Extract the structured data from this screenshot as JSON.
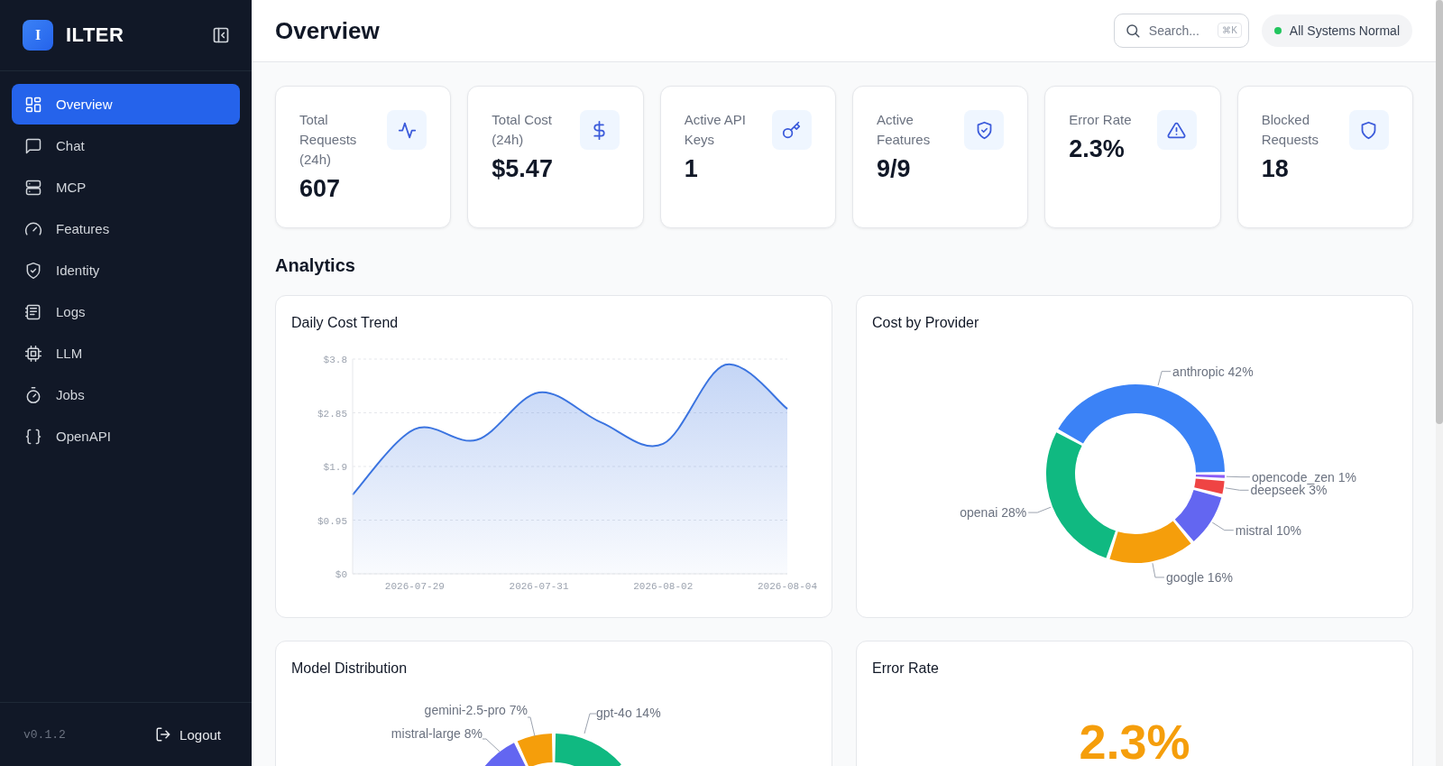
{
  "brand": {
    "logo_letter": "I",
    "name": "ILTER"
  },
  "sidebar": {
    "items": [
      {
        "label": "Overview",
        "selected": true
      },
      {
        "label": "Chat",
        "selected": false
      },
      {
        "label": "MCP",
        "selected": false
      },
      {
        "label": "Features",
        "selected": false
      },
      {
        "label": "Identity",
        "selected": false
      },
      {
        "label": "Logs",
        "selected": false
      },
      {
        "label": "LLM",
        "selected": false
      },
      {
        "label": "Jobs",
        "selected": false
      },
      {
        "label": "OpenAPI",
        "selected": false
      }
    ],
    "version": "v0.1.2",
    "logout": "Logout"
  },
  "header": {
    "title": "Overview",
    "search": {
      "placeholder": "Search...",
      "shortcut": "⌘K"
    },
    "status": {
      "label": "All Systems Normal"
    }
  },
  "stats": [
    {
      "kind": "requests",
      "label": "Total Requests (24h)",
      "value": "607"
    },
    {
      "kind": "cost",
      "label": "Total Cost (24h)",
      "value": "$5.47"
    },
    {
      "kind": "keys",
      "label": "Active API Keys",
      "value": "1"
    },
    {
      "kind": "features",
      "label": "Active Features",
      "value": "9/9"
    },
    {
      "kind": "errors",
      "label": "Error Rate",
      "value": "2.3%"
    },
    {
      "kind": "blocked",
      "label": "Blocked Requests",
      "value": "18"
    }
  ],
  "analytics": {
    "heading": "Analytics",
    "cost_trend": {
      "chart_data": {
        "type": "area",
        "title": "Daily Cost Trend",
        "categories": [
          null,
          "2026-07-29",
          null,
          "2026-07-31",
          null,
          "2026-08-02",
          null,
          "2026-08-04"
        ],
        "series": [
          {
            "color": "#3b74e0",
            "values": [
              1.4,
              2.56,
              2.37,
              3.21,
              2.68,
              2.3,
              3.7,
              2.92
            ]
          }
        ],
        "ylim": [
          0,
          3.8
        ],
        "grid": true,
        "yticks": [
          {
            "value": 0,
            "label": "$0"
          },
          {
            "value": 0.95,
            "label": "$0.95"
          },
          {
            "value": 1.9,
            "label": "$1.9"
          },
          {
            "value": 2.85,
            "label": "$2.85"
          },
          {
            "value": 3.8,
            "label": "$3.8"
          }
        ]
      }
    },
    "cost_by_provider": {
      "chart_data": {
        "type": "donut",
        "title": "Cost by Provider",
        "categories": [
          "anthropic",
          "openai",
          "google",
          "mistral",
          "deepseek",
          "opencode_zen"
        ],
        "values": [
          42,
          28,
          16,
          10,
          3,
          1
        ],
        "colors": [
          "#3b82f6",
          "#10b981",
          "#f59e0b",
          "#6366f1",
          "#ef4444",
          "#8b5cf6"
        ],
        "value_labels": [
          "42%",
          "28%",
          "16%",
          "10%",
          "3%",
          "1%"
        ]
      }
    },
    "model_distribution": {
      "title": "Model Distribution",
      "slices": [
        {
          "label": "gpt-4o 14%",
          "color": "#10b981"
        },
        {
          "label": "gemini-2.5-pro 7%",
          "color": "#f59e0b"
        },
        {
          "label": "mistral-large 8%",
          "color": "#6366f1"
        }
      ]
    },
    "error_rate": {
      "title": "Error Rate",
      "value": "2.3%"
    }
  }
}
